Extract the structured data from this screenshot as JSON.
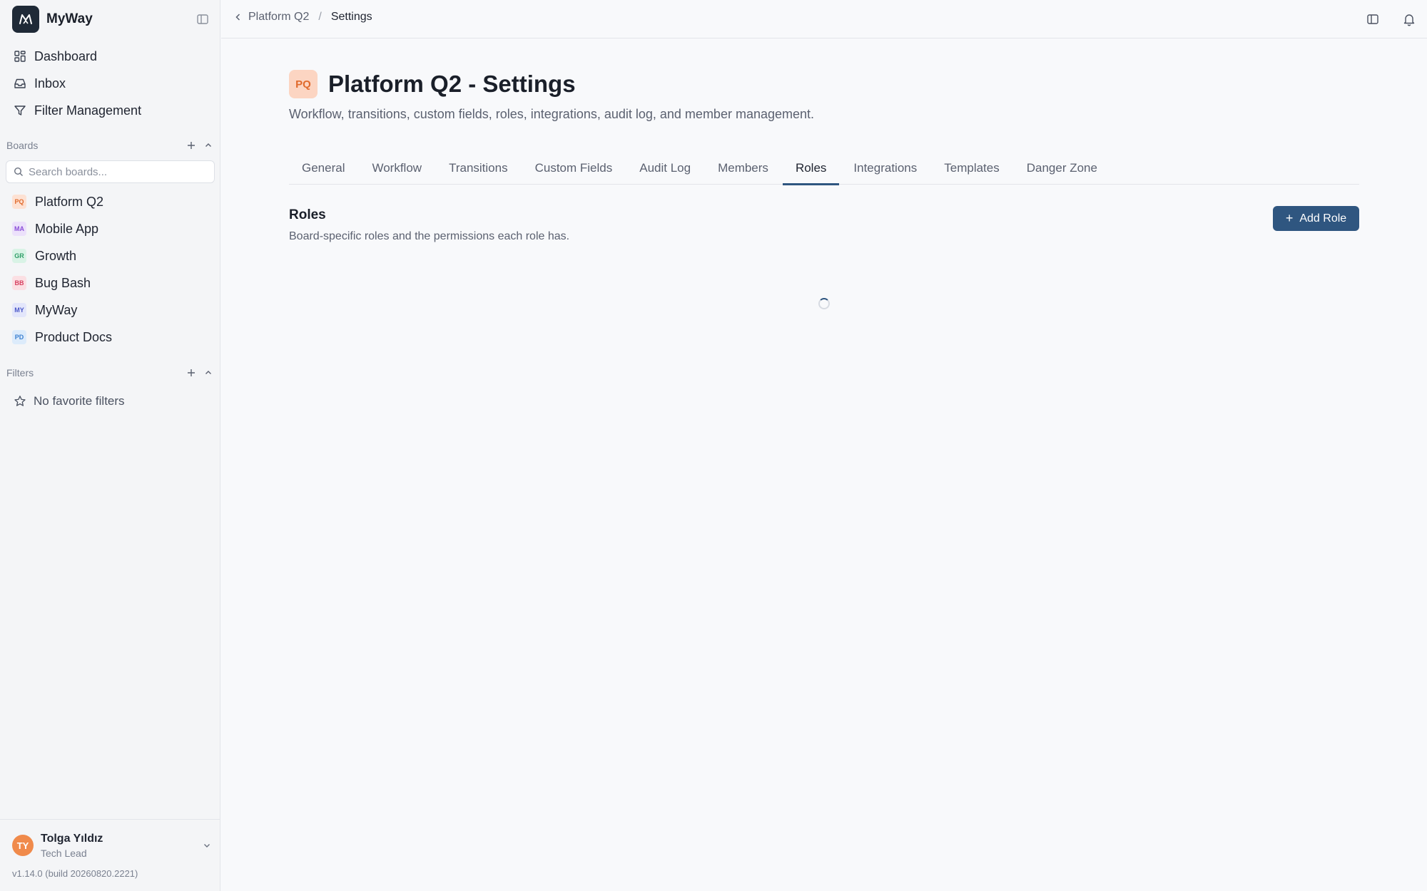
{
  "app": {
    "name": "MyWay"
  },
  "sidebar": {
    "nav": [
      {
        "label": "Dashboard",
        "icon": "dashboard-icon"
      },
      {
        "label": "Inbox",
        "icon": "inbox-icon"
      },
      {
        "label": "Filter Management",
        "icon": "filter-icon"
      }
    ],
    "boards_heading": "Boards",
    "search_placeholder": "Search boards...",
    "boards": [
      {
        "badge": "PQ",
        "label": "Platform Q2",
        "badge_bg": "#fde1d3",
        "badge_fg": "#e06a2c"
      },
      {
        "badge": "MA",
        "label": "Mobile App",
        "badge_bg": "#ece1fb",
        "badge_fg": "#8b4fd8"
      },
      {
        "badge": "GR",
        "label": "Growth",
        "badge_bg": "#d9f3e6",
        "badge_fg": "#2f9d68"
      },
      {
        "badge": "BB",
        "label": "Bug Bash",
        "badge_bg": "#fbdfe3",
        "badge_fg": "#d64060"
      },
      {
        "badge": "MY",
        "label": "MyWay",
        "badge_bg": "#e3e6fb",
        "badge_fg": "#4a57c8"
      },
      {
        "badge": "PD",
        "label": "Product Docs",
        "badge_bg": "#dcebfb",
        "badge_fg": "#3a7fd0"
      }
    ],
    "filters_heading": "Filters",
    "filters_empty": "No favorite filters",
    "user": {
      "initials": "TY",
      "name": "Tolga Yıldız",
      "role": "Tech Lead"
    },
    "version": "v1.14.0 (build 20260820.2221)"
  },
  "breadcrumb": {
    "parent": "Platform Q2",
    "separator": "/",
    "current": "Settings"
  },
  "page": {
    "badge": "PQ",
    "title": "Platform Q2 - Settings",
    "subtitle": "Workflow, transitions, custom fields, roles, integrations, audit log, and member management."
  },
  "tabs": [
    "General",
    "Workflow",
    "Transitions",
    "Custom Fields",
    "Audit Log",
    "Members",
    "Roles",
    "Integrations",
    "Templates",
    "Danger Zone"
  ],
  "active_tab": "Roles",
  "roles_section": {
    "title": "Roles",
    "description": "Board-specific roles and the permissions each role has.",
    "add_button": "Add Role"
  },
  "colors": {
    "accent": "#2f5680",
    "sidebar_bg": "#f4f5f7",
    "page_bg": "#f8f9fb"
  }
}
